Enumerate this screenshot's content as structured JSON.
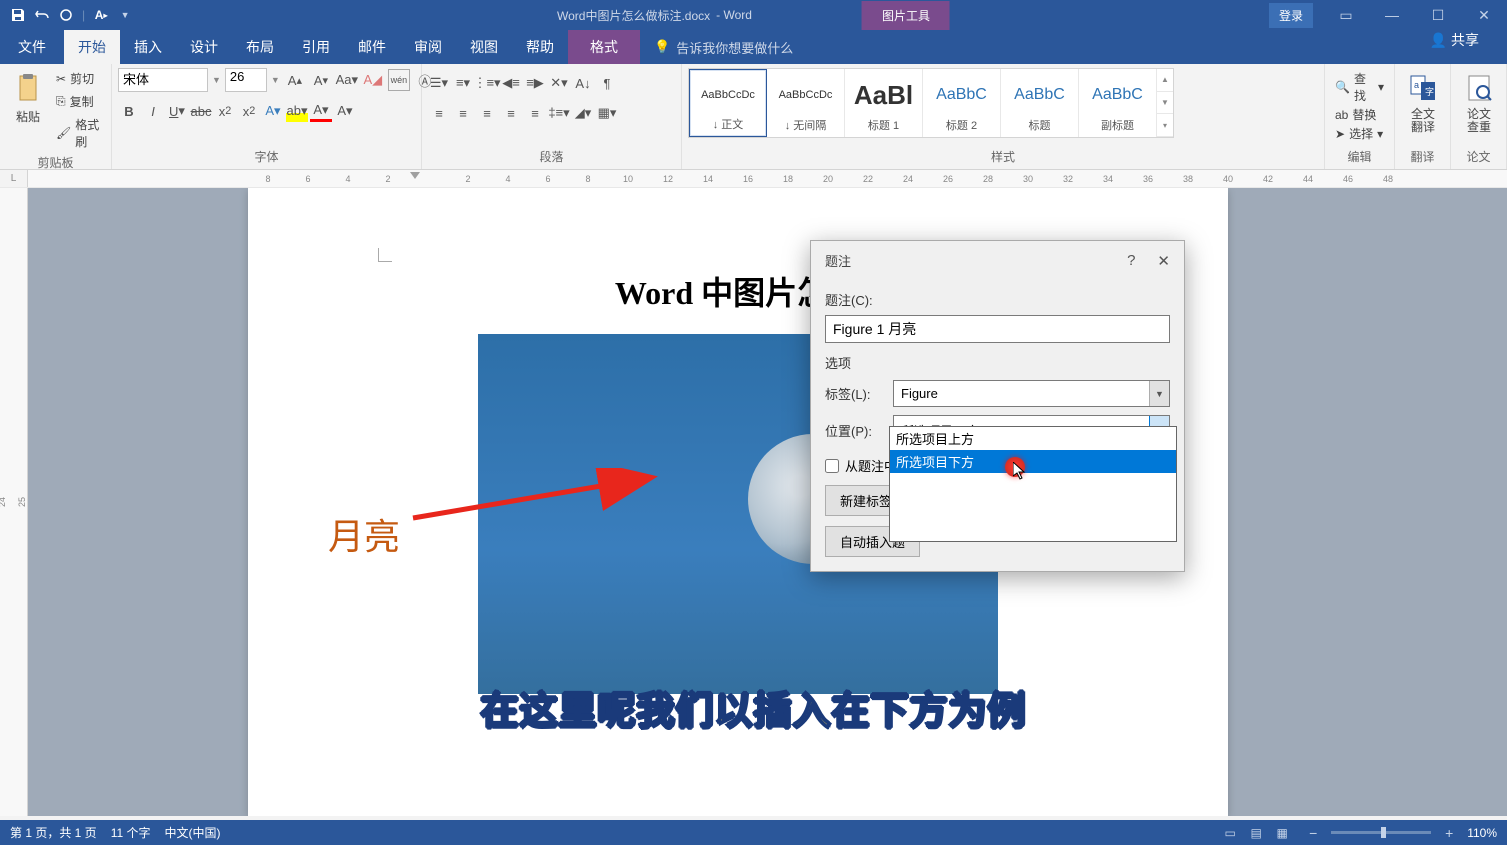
{
  "titlebar": {
    "doc_title": "Word中图片怎么做标注.docx",
    "app_name": " - Word",
    "pic_tools": "图片工具",
    "login": "登录"
  },
  "tabs": {
    "file": "文件",
    "home": "开始",
    "insert": "插入",
    "design": "设计",
    "layout": "布局",
    "ref": "引用",
    "mail": "邮件",
    "review": "审阅",
    "view": "视图",
    "help": "帮助",
    "format": "格式",
    "tellme": "告诉我你想要做什么",
    "share": "共享"
  },
  "ribbon": {
    "clipboard": {
      "paste": "粘贴",
      "cut": "剪切",
      "copy": "复制",
      "fmt": "格式刷",
      "label": "剪贴板"
    },
    "font": {
      "name": "宋体",
      "size": "26",
      "label": "字体"
    },
    "paragraph": {
      "label": "段落"
    },
    "styles": {
      "items": [
        {
          "preview": "AaBbCcDc",
          "name": "↓ 正文",
          "cls": ""
        },
        {
          "preview": "AaBbCcDc",
          "name": "↓ 无间隔",
          "cls": ""
        },
        {
          "preview": "AaBl",
          "name": "标题 1",
          "cls": "big"
        },
        {
          "preview": "AaBbC",
          "name": "标题 2",
          "cls": "med"
        },
        {
          "preview": "AaBbC",
          "name": "标题",
          "cls": "med"
        },
        {
          "preview": "AaBbC",
          "name": "副标题",
          "cls": "med"
        }
      ],
      "label": "样式"
    },
    "editing": {
      "find": "查找",
      "replace": "替换",
      "select": "选择",
      "label": "编辑"
    },
    "translate": {
      "btn": "全文\n翻译",
      "label": "翻译"
    },
    "check": {
      "btn": "论文\n查重",
      "label": "论文"
    }
  },
  "document": {
    "title": "Word 中图片怎么",
    "label": "月亮"
  },
  "dialog": {
    "title": "题注",
    "caption_label": "题注(C):",
    "caption_value": "Figure 1 月亮",
    "options": "选项",
    "label_lbl": "标签(L):",
    "label_val": "Figure",
    "pos_lbl": "位置(P):",
    "pos_val": "所选项目下方",
    "exclude": "从题注中",
    "new_label": "新建标签",
    "auto": "自动插入题",
    "dropdown": {
      "above": "所选项目上方",
      "below": "所选项目下方"
    }
  },
  "subtitle": "在这里呢我们以插入在下方为例",
  "statusbar": {
    "page": "第 1 页，共 1 页",
    "words": "11 个字",
    "lang": "中文(中国)",
    "zoom": "110%"
  }
}
